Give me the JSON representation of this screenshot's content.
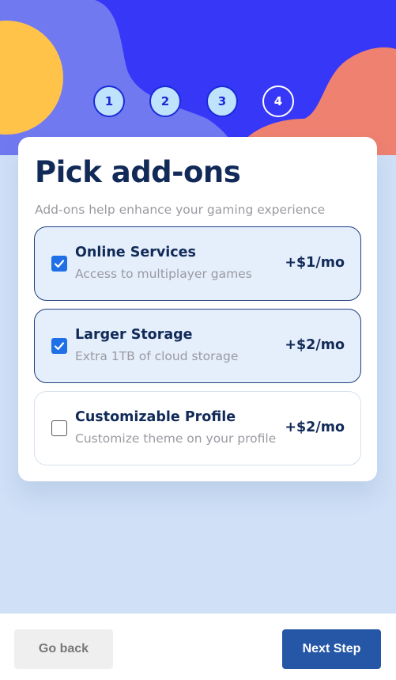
{
  "steps": [
    "1",
    "2",
    "3",
    "4"
  ],
  "active_step": 4,
  "page": {
    "title": "Pick add-ons",
    "subtitle": "Add-ons help enhance your gaming experience"
  },
  "addons": [
    {
      "name": "Online Services",
      "description": "Access to multiplayer games",
      "price": "+$1/mo",
      "checked": true
    },
    {
      "name": "Larger Storage",
      "description": "Extra 1TB of cloud storage",
      "price": "+$2/mo",
      "checked": true
    },
    {
      "name": "Customizable Profile",
      "description": "Customize theme on your profile",
      "price": "+$2/mo",
      "checked": false
    }
  ],
  "footer": {
    "back_label": "Go back",
    "next_label": "Next Step"
  },
  "colors": {
    "hero_blue": "#3737f8",
    "hero_blob": "#7179f1",
    "sun": "#ffc349",
    "coral": "#ee8170",
    "page_bg": "#cfe0f7",
    "marine": "#112a58",
    "accent": "#2557a6"
  }
}
